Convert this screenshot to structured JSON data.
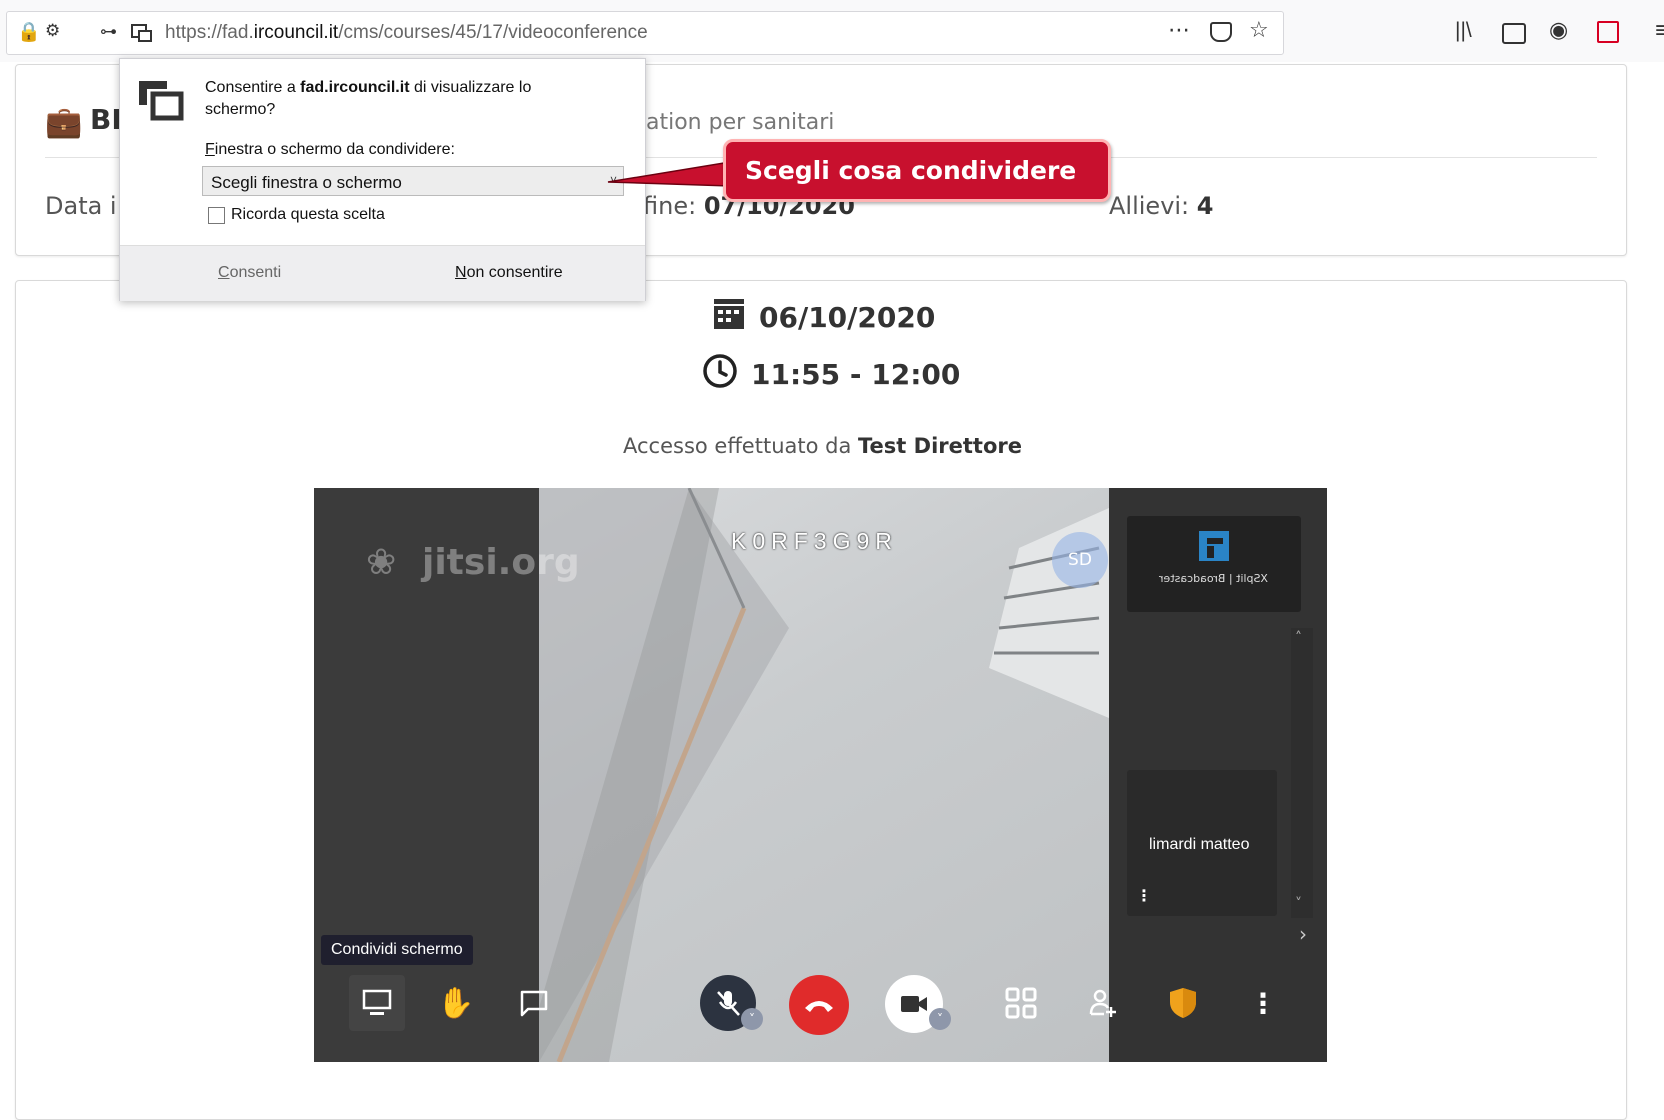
{
  "browser": {
    "url_prefix": "https://fad.",
    "url_domain": "ircouncil.it",
    "url_path": "/cms/courses/45/17/videoconference"
  },
  "course": {
    "title_visible": "BL",
    "subtitle_fragment": "ation per sanitari",
    "start_label_fragment": "Data i",
    "end_label_fragment": "fine:",
    "end_value_fragment": "07/10/2020",
    "students_label": "Allievi:",
    "students_value": "4"
  },
  "session": {
    "date": "06/10/2020",
    "time": "11:55 - 12:00",
    "access_prefix": "Accesso effettuato da",
    "access_user": "Test Direttore"
  },
  "popup": {
    "question_prefix": "Consentire a",
    "question_domain": "fad.ircouncil.it",
    "question_suffix": "di visualizzare lo",
    "question_line2": "schermo?",
    "select_label_first": "F",
    "select_label_rest": "inestra o schermo da condividere:",
    "select_value": "Scegli finestra o schermo",
    "remember_label": "Ricorda questa scelta",
    "allow_first": "C",
    "allow_rest": "onsenti",
    "deny_first": "N",
    "deny_rest": "on consentire"
  },
  "callout": {
    "text": "Scegli cosa condividere"
  },
  "video": {
    "room_code": "K0RF3G9R",
    "watermark": "jitsi.org",
    "avatar_initials": "SD",
    "thumb1_text": "XSplit | Broadcaster",
    "thumb2_name": "limardi matteo",
    "tooltip": "Condividi schermo"
  },
  "colors": {
    "callout": "#c8102e",
    "hangup": "#e02b2b",
    "shield": "#f0a21c"
  }
}
